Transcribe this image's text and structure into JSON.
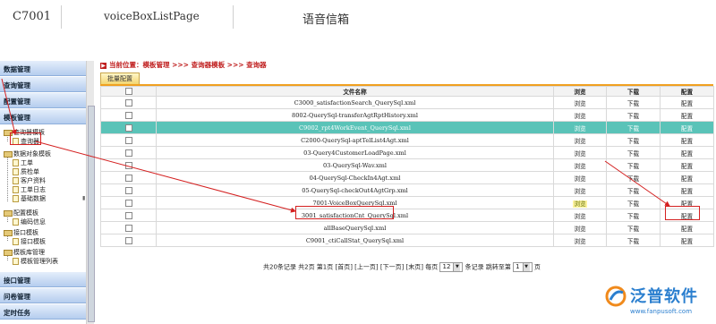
{
  "header": {
    "id": "C7001",
    "page": "voiceBoxListPage",
    "title": "语音信箱"
  },
  "sidebar": {
    "sections_top": [
      "数据管理",
      "查询管理",
      "配置管理",
      "模板管理"
    ],
    "tree": {
      "n1": "查询器模板",
      "n1_child": "查询器",
      "n2": "数据对象模板",
      "n2_children": [
        "工单",
        "质检单",
        "客户资料",
        "工单日志",
        "基础数据"
      ],
      "n3": "配置模板",
      "n3_children": [
        "编码信息"
      ],
      "n4": "接口模板",
      "n4_children": [
        "接口模板"
      ],
      "n5": "模板库管理",
      "n5_children": [
        "模板管理列表"
      ]
    },
    "sections_bottom": [
      "接口管理",
      "问卷管理",
      "定时任务"
    ]
  },
  "breadcrumb": "当前位置：模板管理 >>> 查询器模板 >>> 查询器",
  "tab": "批量配置",
  "table": {
    "headers": [
      "",
      "文件名称",
      "浏览",
      "下载",
      "配置"
    ],
    "rows": [
      {
        "file": "C3000_satisfactionSearch_QuerySql.xml",
        "view": "浏览",
        "download": "下载",
        "config": "配置"
      },
      {
        "file": "8002-QuerySql-transferAgtRptHistory.xml",
        "view": "浏览",
        "download": "下载",
        "config": "配置"
      },
      {
        "file": "C9002_rpt4WorkEvent_QuerySql.xml",
        "view": "浏览",
        "download": "下载",
        "config": "配置"
      },
      {
        "file": "C2000-QuerySql-aptTelList4Agt.xml",
        "view": "浏览",
        "download": "下载",
        "config": "配置"
      },
      {
        "file": "03-Query4CustomerLoadPage.xml",
        "view": "浏览",
        "download": "下载",
        "config": "配置"
      },
      {
        "file": "03-QuerySql-Wav.xml",
        "view": "浏览",
        "download": "下载",
        "config": "配置"
      },
      {
        "file": "04-QuerySql-CheckIn4Agt.xml",
        "view": "浏览",
        "download": "下载",
        "config": "配置"
      },
      {
        "file": "05-QuerySql-checkOut4AgtGrp.xml",
        "view": "浏览",
        "download": "下载",
        "config": "配置"
      },
      {
        "file": "7001-VoiceBoxQuerySql.xml",
        "view": "浏览",
        "download": "下载",
        "config": "配置"
      },
      {
        "file": "3001_satisfactionCnt_QuerySql.xml",
        "view": "浏览",
        "download": "下载",
        "config": "配置"
      },
      {
        "file": "allBaseQuerySql.xml",
        "view": "浏览",
        "download": "下载",
        "config": "配置"
      },
      {
        "file": "C9001_ctiCallStat_QuerySql.xml",
        "view": "浏览",
        "download": "下载",
        "config": "配置"
      }
    ]
  },
  "pager": {
    "summary": "共20条记录 共2页 第1页 [首页] [上一页] [下一页] [末页] 每页",
    "per_page": "12",
    "per_page_suffix": "条记录 跳转至第",
    "goto": "1",
    "goto_suffix": "页"
  },
  "logo": {
    "name": "泛普软件",
    "url": "www.fanpusoft.com"
  },
  "colors": {
    "highlight_row": "#5ac3b8",
    "annotation": "#d42020",
    "accent": "#f0a020"
  }
}
